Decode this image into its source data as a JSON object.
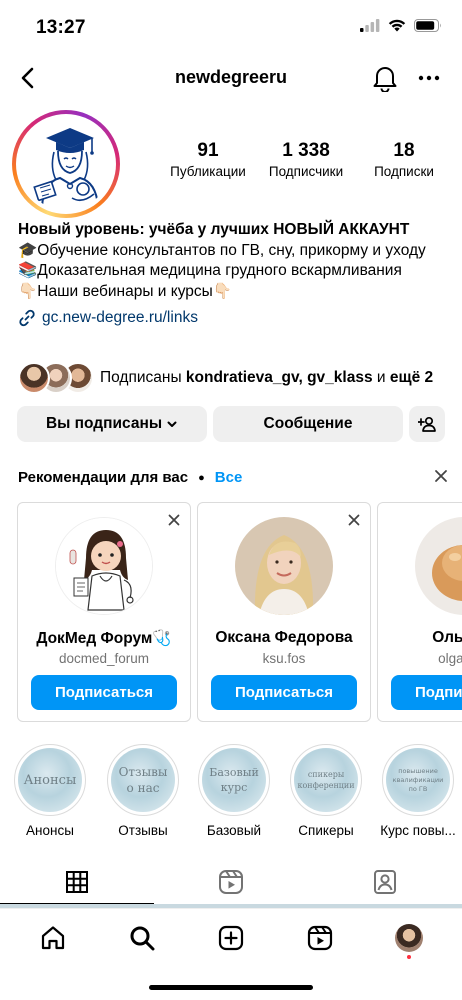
{
  "status_bar": {
    "time": "13:27"
  },
  "header": {
    "username": "newdegreeru"
  },
  "profile": {
    "stats": [
      {
        "value": "91",
        "label": "Публикации"
      },
      {
        "value": "1 338",
        "label": "Подписчики"
      },
      {
        "value": "18",
        "label": "Подписки"
      }
    ],
    "bio": {
      "name": "Новый уровень: учёба у лучших НОВЫЙ АККАУНТ",
      "line1": "🎓Обучение консультантов по ГВ, сну, прикорму и уходу",
      "line2": "📚Доказательная медицина грудного вскармливания",
      "line3": "👇🏻Наши вебинары и курсы👇🏻",
      "link": "gc.new-degree.ru/links"
    },
    "followed_by": {
      "prefix": "Подписаны",
      "names": "kondratieva_gv, gv_klass",
      "joiner": "и",
      "more": "ещё 2"
    }
  },
  "buttons": {
    "subscribed": "Вы подписаны",
    "message": "Сообщение"
  },
  "suggestions": {
    "title": "Рекомендации для вас",
    "see_all": "Все",
    "cards": [
      {
        "name": "ДокМед Форум🩺",
        "handle": "docmed_forum",
        "button": "Подписаться"
      },
      {
        "name": "Оксана Федорова",
        "handle": "ksu.fos",
        "button": "Подписаться"
      },
      {
        "name": "Ольга М",
        "handle": "olga_ma",
        "button": "Подписаться"
      }
    ]
  },
  "highlights": [
    {
      "cover_text": "Анонсы",
      "label": "Анонсы"
    },
    {
      "cover_text": "Отзывы о нас",
      "label": "Отзывы"
    },
    {
      "cover_text": "Базовый курс",
      "label": "Базовый"
    },
    {
      "cover_text": "спикеры конференции",
      "label": "Спикеры"
    },
    {
      "cover_text": "повышение квалификации по ГВ",
      "label": "Курс повы..."
    }
  ],
  "colors": {
    "accent_blue": "#0095f6",
    "link_blue": "#00376b",
    "button_gray": "#efefef",
    "notification_red": "#ff3040"
  },
  "icons": {
    "header": [
      "chevron-left-icon",
      "bell-icon",
      "more-horizontal-icon"
    ],
    "tabs": [
      "grid-icon",
      "reels-icon",
      "tagged-icon"
    ],
    "bottom_nav": [
      "home-icon",
      "search-icon",
      "new-post-icon",
      "reels-icon",
      "profile-avatar"
    ]
  }
}
